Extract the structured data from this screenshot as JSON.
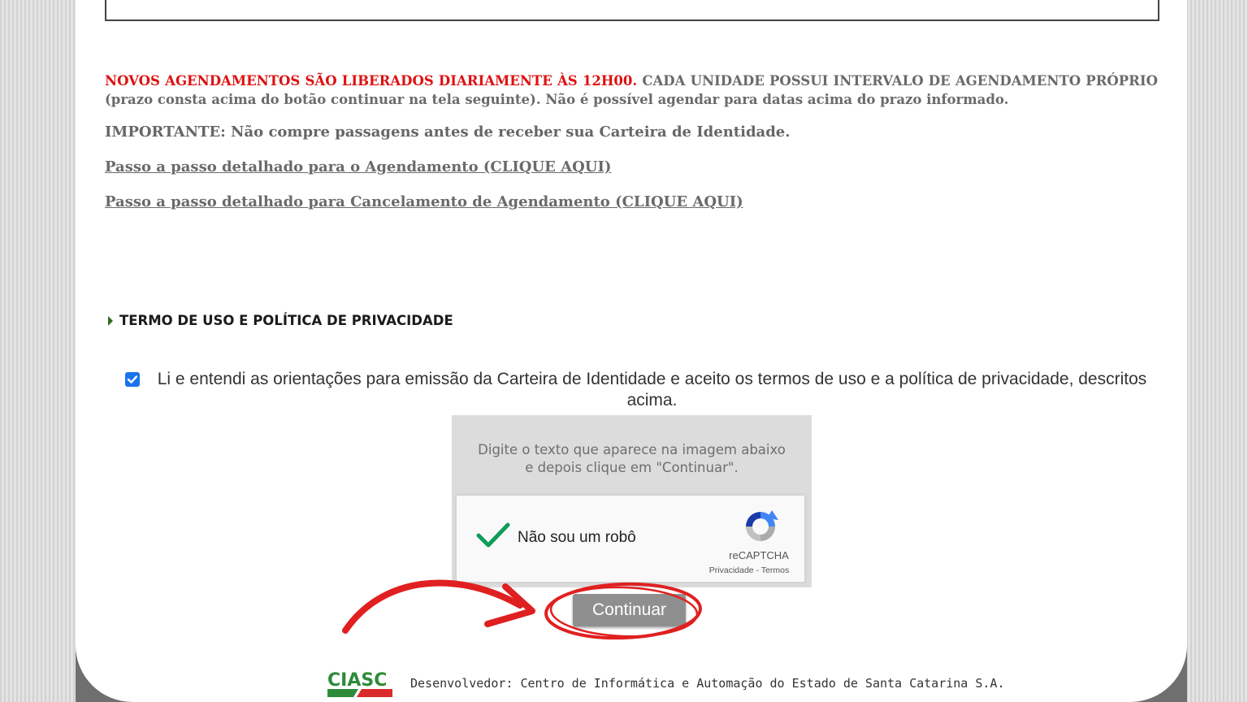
{
  "notice": {
    "red_text": "NOVOS AGENDAMENTOS SÃO LIBERADOS DIARIAMENTE ÀS 12H00.",
    "gray_text": "CADA UNIDADE POSSUI INTERVALO DE AGENDAMENTO PRÓPRIO (prazo consta acima do botão continuar na tela seguinte). Não é possível agendar para datas acima do prazo informado."
  },
  "important": "IMPORTANTE: Não compre passagens antes de receber sua Carteira de Identidade.",
  "links": {
    "scheduling": "Passo a passo detalhado para o Agendamento (CLIQUE AQUI)",
    "cancellation": "Passo a passo detalhado para Cancelamento de Agendamento (CLIQUE AQUI)"
  },
  "section": {
    "title": "TERMO DE USO E POLÍTICA DE PRIVACIDADE"
  },
  "consent": {
    "checked": true,
    "text": "Li e entendi as orientações para emissão da Carteira de Identidade e aceito os termos de uso e a política de privacidade, descritos acima."
  },
  "captcha": {
    "instruction_line1": "Digite o texto que aparece na imagem abaixo",
    "instruction_line2": "e depois clique em \"Continuar\".",
    "label": "Não sou um robô",
    "brand": "reCAPTCHA",
    "links": "Privacidade - Termos"
  },
  "continue_label": "Continuar",
  "footer": {
    "logo_text": "CIASC",
    "developer": "Desenvolvedor: Centro de Informática e Automação do Estado de Santa Catarina S.A."
  },
  "colors": {
    "notice_red": "#dd1111",
    "checkbox_blue": "#1a73e8",
    "checkmark_green": "#0f9d58",
    "annotation_red": "#e02020",
    "logo_green": "#2e8b3a"
  }
}
